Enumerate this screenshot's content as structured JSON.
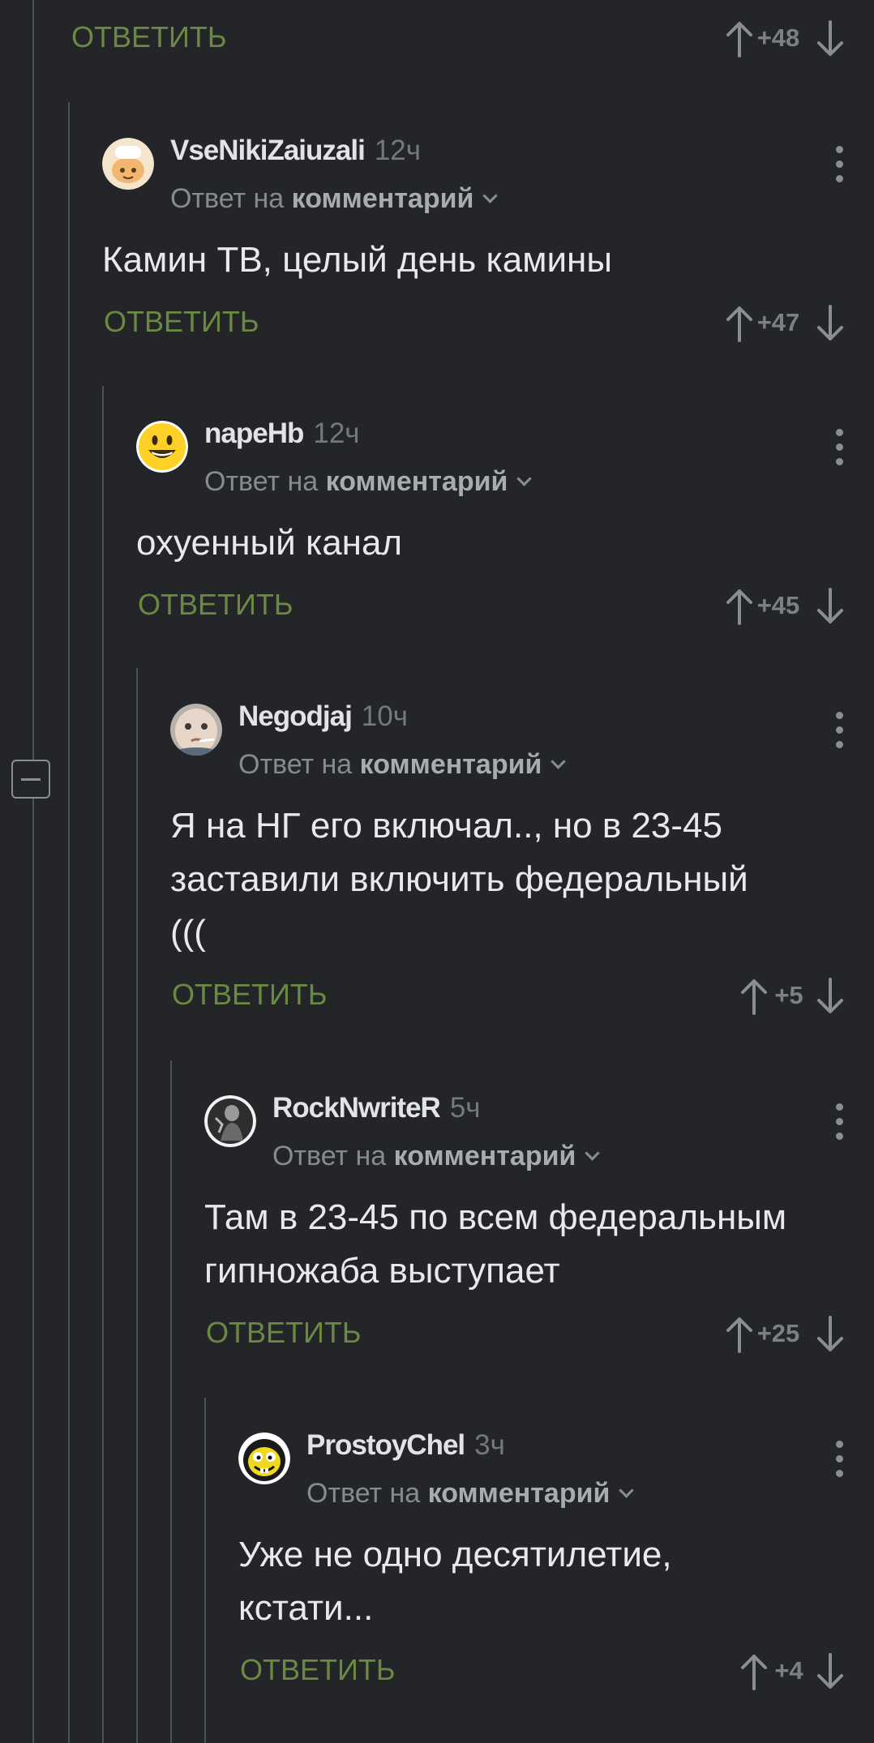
{
  "ui": {
    "reply_label": "ОТВЕТИТЬ",
    "reply_prefix": "Ответ на",
    "reply_target": "комментарий"
  },
  "top_row": {
    "rating": "+48"
  },
  "comments": [
    {
      "author": "VseNikiZaiuzali",
      "time": "12ч",
      "avatar": "cook-avatar",
      "lines": [
        "Камин ТВ, целый день камины"
      ],
      "rating": "+47"
    },
    {
      "author": "napeHb",
      "time": "12ч",
      "avatar": "smiley-avatar",
      "lines": [
        "охуенный канал"
      ],
      "rating": "+45"
    },
    {
      "author": "Negodjaj",
      "time": "10ч",
      "avatar": "baby-avatar",
      "lines": [
        "Я на НГ его включал.., но в 23-45",
        "заставили включить федеральный",
        "((("
      ],
      "rating": "+5"
    },
    {
      "author": "RockNwriteR",
      "time": "5ч",
      "avatar": "rock-avatar",
      "lines": [
        "Там в 23-45 по всем федеральным",
        "гипножаба выступает"
      ],
      "rating": "+25"
    },
    {
      "author": "ProstoyChel",
      "time": "3ч",
      "avatar": "troll-face-avatar",
      "lines": [
        "Уже не одно десятилетие,",
        "кстати..."
      ],
      "rating": "+4"
    }
  ]
}
